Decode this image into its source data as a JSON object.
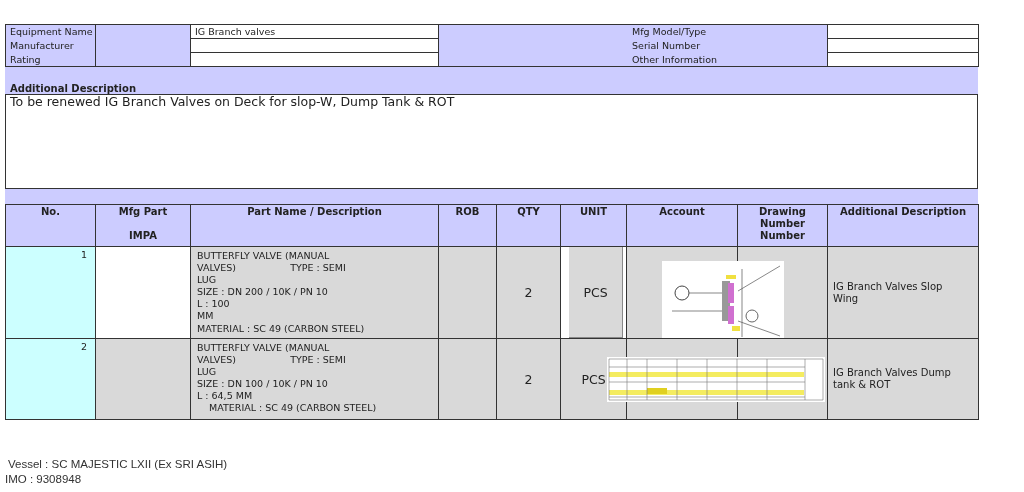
{
  "equipment": {
    "left_fields": [
      {
        "label": "Equipment Name",
        "value": "IG Branch valves"
      },
      {
        "label": "Manufacturer"
      },
      {
        "label": "Rating"
      }
    ],
    "right_fields": [
      {
        "label": "Mfg Model/Type"
      },
      {
        "label": "Serial Number"
      },
      {
        "label": "Other Information"
      }
    ]
  },
  "additional_description": {
    "heading": "Additional Description",
    "text": "To be renewed IG Branch Valves on Deck for slop-W, Dump Tank & ROT"
  },
  "table": {
    "columns": [
      "No.",
      "Mfg Part\n\nIMPA",
      "Part Name / Description",
      "ROB",
      "QTY",
      "UNIT",
      "Account",
      "Drawing\nNumber\nNumber",
      "Additional Description"
    ],
    "rows": [
      {
        "no": "1",
        "mfg_part_white": true,
        "description": "BUTTERFLY VALVE (MANUAL\nVALVES)                  TYPE : SEMI\nLUG\nSIZE : DN 200 / 10K / PN 10\nL : 100\nMM\nMATERIAL : SC 49 (CARBON STEEL)",
        "qty": "2",
        "unit": "PCS",
        "unit_boxed": true,
        "additional_description": "IG Branch Valves Slop Wing"
      },
      {
        "no": "2",
        "mfg_part_white": false,
        "description": "BUTTERFLY VALVE (MANUAL\nVALVES)                  TYPE : SEMI\nLUG\nSIZE : DN 100 / 10K / PN 10\nL : 64,5 MM\n    MATERIAL : SC 49 (CARBON STEEL)",
        "qty": "2",
        "unit": "PCS",
        "unit_boxed": false,
        "additional_description": "IG Branch Valves Dump tank & ROT"
      }
    ]
  },
  "footer": {
    "vessel": "Vessel : SC MAJESTIC LXII (Ex SRI ASIH)",
    "imo": "IMO : 9308948"
  }
}
